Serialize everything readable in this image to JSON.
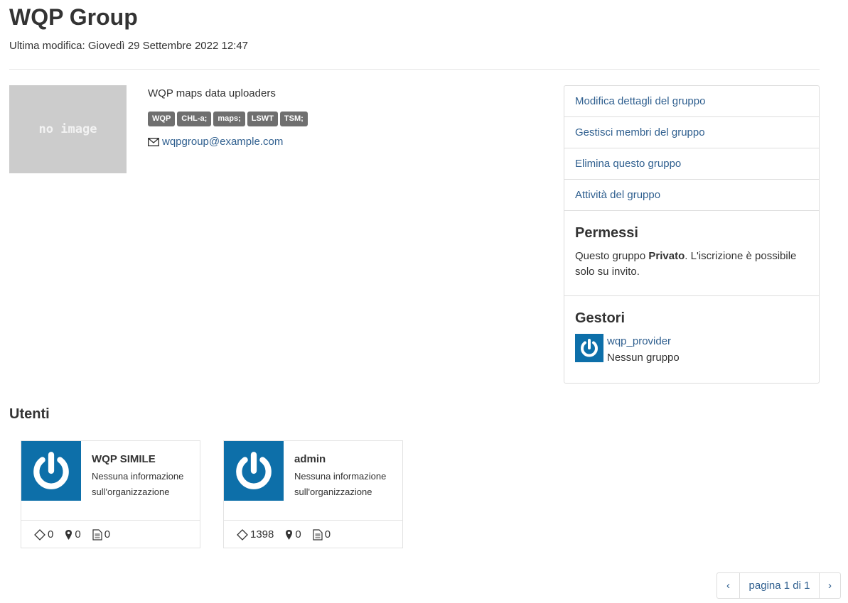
{
  "page": {
    "title": "WQP Group",
    "last_modified": "Ultima modifica: Giovedì 29 Settembre 2022 12:47"
  },
  "group": {
    "image_placeholder": "no image",
    "description": "WQP maps data uploaders",
    "tags": [
      "WQP",
      "CHL-a;",
      "maps;",
      "LSWT",
      "TSM;"
    ],
    "email": "wqpgroup@example.com"
  },
  "side_panel": {
    "links": [
      "Modifica dettagli del gruppo",
      "Gestisci membri del gruppo",
      "Elimina questo gruppo",
      "Attività del gruppo"
    ],
    "permissions": {
      "heading": "Permessi",
      "text_before": "Questo gruppo ",
      "text_bold": "Privato",
      "text_after": ". L'iscrizione è possibile solo su invito."
    },
    "managers": {
      "heading": "Gestori",
      "name": "wqp_provider",
      "org": "Nessun gruppo"
    }
  },
  "users": {
    "heading": "Utenti",
    "cards": [
      {
        "name": "WQP SIMILE",
        "org": "Nessuna informazione sull'organizzazione",
        "datasets": "0",
        "locations": "0",
        "docs": "0"
      },
      {
        "name": "admin",
        "org": "Nessuna informazione sull'organizzazione",
        "datasets": "1398",
        "locations": "0",
        "docs": "0"
      }
    ]
  },
  "pagination": {
    "prev": "‹",
    "label": "pagina 1 di 1",
    "next": "›"
  },
  "colors": {
    "accent": "#2f5f8f",
    "avatar_bg": "#0d6fa9",
    "tag_bg": "#6f6f6f"
  }
}
